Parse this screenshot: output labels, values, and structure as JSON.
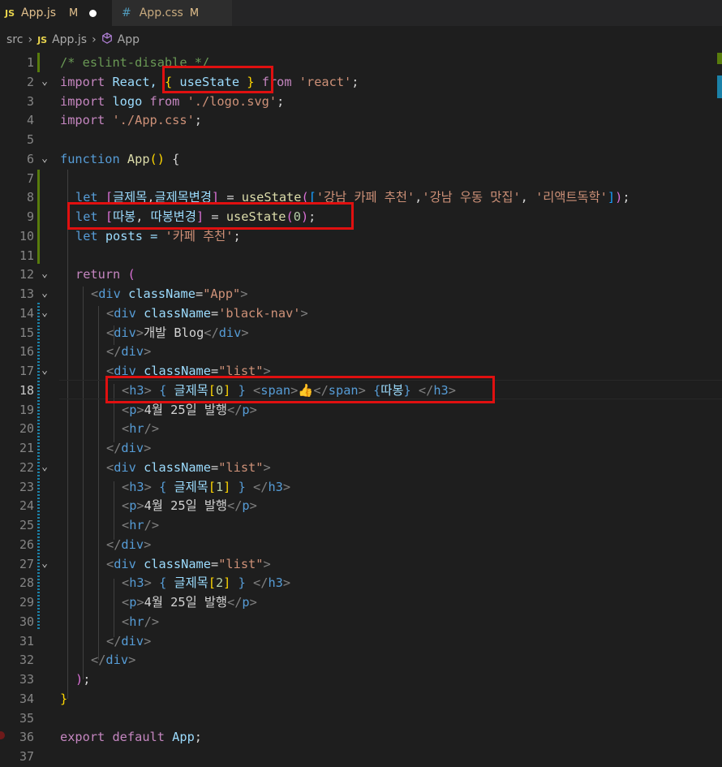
{
  "tabs": [
    {
      "icon": "JS",
      "name": "App.js",
      "status": "M",
      "unsaved": true
    },
    {
      "icon": "#",
      "name": "App.css",
      "status": "M"
    }
  ],
  "breadcrumb": {
    "folder": "src",
    "file_icon": "JS",
    "file": "App.js",
    "symbol": "App"
  },
  "code": {
    "line_numbers": [
      "1",
      "2",
      "3",
      "4",
      "5",
      "6",
      "7",
      "8",
      "9",
      "10",
      "11",
      "12",
      "13",
      "14",
      "15",
      "16",
      "17",
      "18",
      "19",
      "20",
      "21",
      "22",
      "23",
      "24",
      "25",
      "26",
      "27",
      "28",
      "29",
      "30",
      "31",
      "32",
      "33",
      "34",
      "35",
      "36",
      "37"
    ],
    "lines": {
      "l1": "/* eslint-disable */",
      "l2": [
        "import",
        " React, ",
        "{",
        " useState ",
        "}",
        " from",
        " 'react'",
        ";"
      ],
      "l3": [
        "import",
        " logo ",
        "from",
        " './logo.svg'",
        ";"
      ],
      "l4": [
        "import",
        " './App.css'",
        ";"
      ],
      "l6": [
        "function",
        " App",
        "()",
        " {"
      ],
      "l8": [
        "let",
        " ",
        "[",
        "글제목",
        ",",
        "글제목변경",
        "]",
        " = ",
        "useState",
        "(",
        "[",
        "'강남 카페 추천'",
        ",",
        "'강남 우동 맛집'",
        ", ",
        "'리액트독학'",
        "]",
        ")",
        ";"
      ],
      "l9": [
        "let",
        " ",
        "[",
        "따봉",
        ", ",
        "따봉변경",
        "]",
        " = ",
        "useState",
        "(",
        "0",
        ")",
        ";"
      ],
      "l10": [
        "let",
        " posts = ",
        "'카페 추천'",
        ";"
      ],
      "l12": [
        "return",
        " ",
        "("
      ],
      "l13": [
        "<",
        "div",
        " className",
        "=",
        "\"App\"",
        ">"
      ],
      "l14": [
        "<",
        "div",
        " className",
        "=",
        "'black-nav'",
        ">"
      ],
      "l15": [
        "<",
        "div",
        ">",
        "개발 Blog",
        "</",
        "div",
        ">"
      ],
      "l16": [
        "</",
        "div",
        ">"
      ],
      "l17": [
        "<",
        "div",
        " className",
        "=",
        "\"list\"",
        ">"
      ],
      "l18": [
        "<",
        "h3",
        ">",
        " ",
        "{",
        " 글제목",
        "[",
        "0",
        "]",
        " ",
        "}",
        " ",
        "<",
        "span",
        ">",
        "👍",
        "</",
        "span",
        ">",
        " ",
        "{",
        "따봉",
        "}",
        " ",
        "</",
        "h3",
        ">"
      ],
      "l19": [
        "<",
        "p",
        ">",
        "4월 25일 발행",
        "</",
        "p",
        ">"
      ],
      "l20": [
        "<",
        "hr",
        "/>"
      ],
      "l21": [
        "</",
        "div",
        ">"
      ],
      "l22": [
        "<",
        "div",
        " className",
        "=",
        "\"list\"",
        ">"
      ],
      "l23": [
        "<",
        "h3",
        ">",
        " ",
        "{",
        " 글제목",
        "[",
        "1",
        "]",
        " ",
        "}",
        " ",
        "</",
        "h3",
        ">"
      ],
      "l24": [
        "<",
        "p",
        ">",
        "4월 25일 발행",
        "</",
        "p",
        ">"
      ],
      "l25": [
        "<",
        "hr",
        "/>"
      ],
      "l26": [
        "</",
        "div",
        ">"
      ],
      "l27": [
        "<",
        "div",
        " className",
        "=",
        "\"list\"",
        ">"
      ],
      "l28": [
        "<",
        "h3",
        ">",
        " ",
        "{",
        " 글제목",
        "[",
        "2",
        "]",
        " ",
        "}",
        " ",
        "</",
        "h3",
        ">"
      ],
      "l29": [
        "<",
        "p",
        ">",
        "4월 25일 발행",
        "</",
        "p",
        ">"
      ],
      "l30": [
        "<",
        "hr",
        "/>"
      ],
      "l31": [
        "</",
        "div",
        ">"
      ],
      "l32": [
        "</",
        "div",
        ">"
      ],
      "l33": [
        ")",
        ";"
      ],
      "l34": [
        "}"
      ],
      "l36": [
        "export",
        " default",
        " App",
        ";"
      ]
    }
  },
  "colors": {
    "annotation_box": "#e01010",
    "editor_bg": "#1e1e1e"
  }
}
